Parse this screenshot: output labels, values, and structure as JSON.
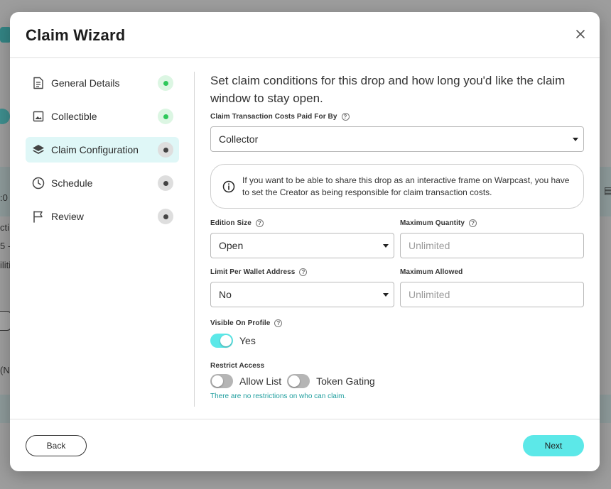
{
  "background": {
    "fragments": [
      ":0",
      "cti",
      "5 -",
      "iliti",
      "<",
      "(Nc"
    ]
  },
  "modal": {
    "title": "Claim Wizard",
    "close_icon": "close-icon"
  },
  "steps": [
    {
      "label": "General Details",
      "icon": "document-icon",
      "status": "done"
    },
    {
      "label": "Collectible",
      "icon": "image-icon",
      "status": "done"
    },
    {
      "label": "Claim Configuration",
      "icon": "layers-icon",
      "status": "pending",
      "active": true
    },
    {
      "label": "Schedule",
      "icon": "clock-icon",
      "status": "pending"
    },
    {
      "label": "Review",
      "icon": "flag-icon",
      "status": "pending"
    }
  ],
  "form": {
    "intro": "Set claim conditions for this drop and how long you'd like the claim window to stay open.",
    "transaction_costs": {
      "label": "Claim Transaction Costs Paid For By",
      "value": "Collector"
    },
    "info": "If you want to be able to share this drop as an interactive frame on Warpcast, you have to set the Creator as being responsible for claim transaction costs.",
    "edition_size": {
      "label": "Edition Size",
      "value": "Open"
    },
    "max_quantity": {
      "label": "Maximum Quantity",
      "placeholder": "Unlimited"
    },
    "limit_per_wallet": {
      "label": "Limit Per Wallet Address",
      "value": "No"
    },
    "max_allowed": {
      "label": "Maximum Allowed",
      "placeholder": "Unlimited"
    },
    "visible_on_profile": {
      "label": "Visible On Profile",
      "toggle_label": "Yes",
      "on": true
    },
    "restrict_access": {
      "label": "Restrict Access",
      "allow_list": "Allow List",
      "token_gating": "Token Gating",
      "helper": "There are no restrictions on who can claim."
    }
  },
  "footer": {
    "back": "Back",
    "next": "Next"
  },
  "colors": {
    "accent": "#5ce8e8",
    "done": "#2ec85a",
    "helper_text": "#1f9e9e"
  }
}
